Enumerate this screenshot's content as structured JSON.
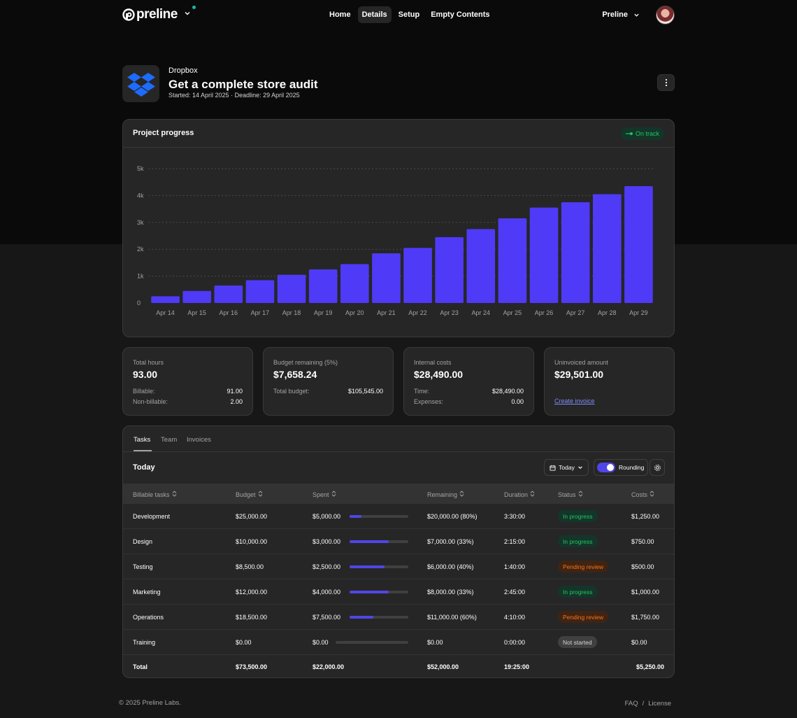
{
  "header": {
    "brand": "preline",
    "nav": [
      {
        "label": "Home",
        "active": false
      },
      {
        "label": "Details",
        "active": true
      },
      {
        "label": "Setup",
        "active": false
      },
      {
        "label": "Empty Contents",
        "active": false
      }
    ],
    "account_label": "Preline"
  },
  "project": {
    "company": "Dropbox",
    "title": "Get a complete store audit",
    "started": "Started: 14 April 2025",
    "deadline": "Deadline: 29 April 2025"
  },
  "progress_card": {
    "title": "Project progress",
    "status": "On track"
  },
  "chart_data": {
    "type": "bar",
    "categories": [
      "Apr 14",
      "Apr 15",
      "Apr 16",
      "Apr 17",
      "Apr 18",
      "Apr 19",
      "Apr 20",
      "Apr 21",
      "Apr 22",
      "Apr 23",
      "Apr 24",
      "Apr 25",
      "Apr 26",
      "Apr 27",
      "Apr 28",
      "Apr 29"
    ],
    "values": [
      250,
      450,
      650,
      850,
      1050,
      1250,
      1450,
      1850,
      2050,
      2450,
      2750,
      3150,
      3550,
      3750,
      4050,
      4350
    ],
    "ylim": [
      0,
      5000
    ],
    "yticks": [
      {
        "v": 0,
        "label": "0"
      },
      {
        "v": 1000,
        "label": "1k"
      },
      {
        "v": 2000,
        "label": "2k"
      },
      {
        "v": 3000,
        "label": "3k"
      },
      {
        "v": 4000,
        "label": "4k"
      },
      {
        "v": 5000,
        "label": "5k"
      }
    ],
    "color": "#4f3af7",
    "grid": true
  },
  "stats": [
    {
      "label": "Total hours",
      "value": "93.00",
      "rows": [
        {
          "k": "Billable:",
          "v": "91.00"
        },
        {
          "k": "Non-billable:",
          "v": "2.00"
        }
      ]
    },
    {
      "label": "Budget remaining (5%)",
      "value": "$7,658.24",
      "rows": [
        {
          "k": "Total budget:",
          "v": "$105,545.00"
        }
      ]
    },
    {
      "label": "Internal costs",
      "value": "$28,490.00",
      "rows": [
        {
          "k": "Time:",
          "v": "$28,490.00"
        },
        {
          "k": "Expenses:",
          "v": "0.00"
        }
      ]
    },
    {
      "label": "Uninvoiced amount",
      "value": "$29,501.00",
      "link": "Create invoice"
    }
  ],
  "tabs": [
    "Tasks",
    "Team",
    "Invoices"
  ],
  "tasks": {
    "title": "Today",
    "date_filter": "Today",
    "rounding_label": "Rounding",
    "columns": [
      "Billable tasks",
      "Budget",
      "Spent",
      "Remaining",
      "Duration",
      "Status",
      "Costs"
    ],
    "rows": [
      {
        "name": "Development",
        "budget": "$25,000.00",
        "spent": "$5,000.00",
        "progress": 0.2,
        "remaining": "$20,000.00 (80%)",
        "duration": "3:30:00",
        "status": "In progress",
        "status_kind": "progress",
        "costs": "$1,250.00"
      },
      {
        "name": "Design",
        "budget": "$10,000.00",
        "spent": "$3,000.00",
        "progress": 0.67,
        "remaining": "$7,000.00 (33%)",
        "duration": "2:15:00",
        "status": "In progress",
        "status_kind": "progress",
        "costs": "$750.00"
      },
      {
        "name": "Testing",
        "budget": "$8,500.00",
        "spent": "$2,500.00",
        "progress": 0.6,
        "remaining": "$6,000.00 (40%)",
        "duration": "1:40:00",
        "status": "Pending review",
        "status_kind": "pending",
        "costs": "$500.00"
      },
      {
        "name": "Marketing",
        "budget": "$12,000.00",
        "spent": "$4,000.00",
        "progress": 0.67,
        "remaining": "$8,000.00 (33%)",
        "duration": "2:45:00",
        "status": "In progress",
        "status_kind": "progress",
        "costs": "$1,000.00"
      },
      {
        "name": "Operations",
        "budget": "$18,500.00",
        "spent": "$7,500.00",
        "progress": 0.4,
        "remaining": "$11,000.00 (60%)",
        "duration": "4:10:00",
        "status": "Pending review",
        "status_kind": "pending",
        "costs": "$1,750.00"
      },
      {
        "name": "Training",
        "budget": "$0.00",
        "spent": "$0.00",
        "progress": 0,
        "remaining": "$0.00",
        "duration": "0:00:00",
        "status": "Not started",
        "status_kind": "none",
        "costs": "$0.00"
      }
    ],
    "total": {
      "name": "Total",
      "budget": "$73,500.00",
      "spent": "$22,000.00",
      "remaining": "$52,000.00",
      "duration": "19:25:00",
      "costs": "$5,250.00"
    }
  },
  "footer": {
    "copyright": "© 2025 Preline Labs.",
    "links": [
      "FAQ",
      "License"
    ]
  }
}
